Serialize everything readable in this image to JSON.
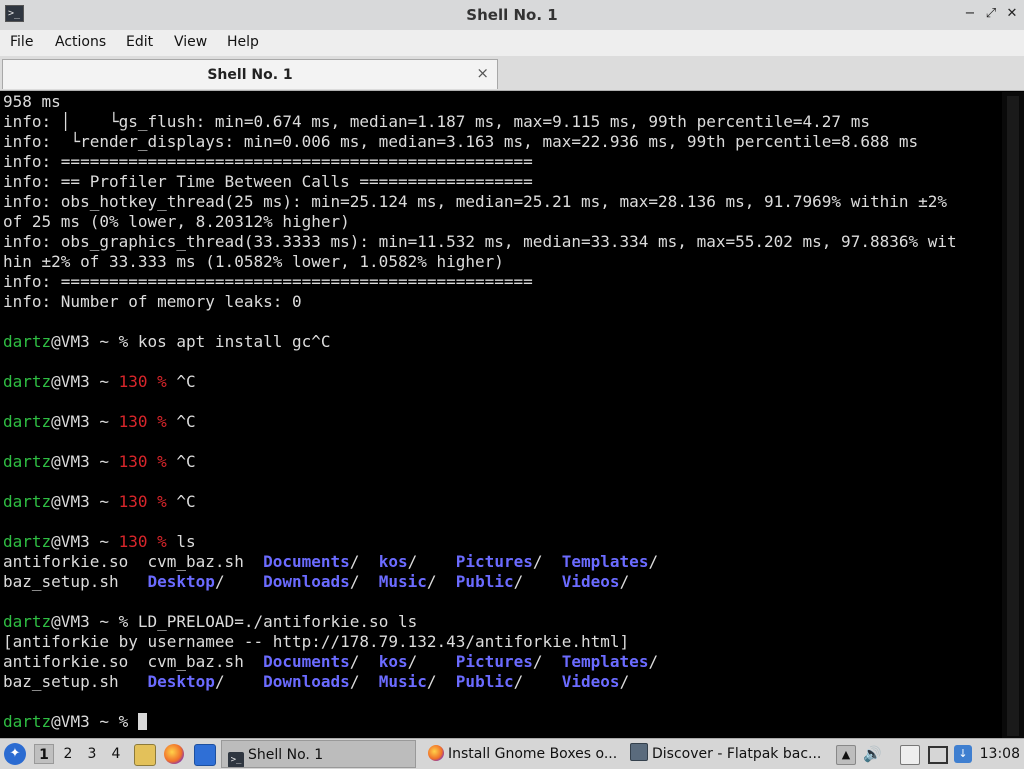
{
  "window": {
    "title": "Shell No. 1",
    "app_icon_glyph": ">_",
    "buttons": {
      "minimize": "−",
      "maximize": "⤢",
      "close": "✕"
    }
  },
  "menu": {
    "items": [
      "File",
      "Actions",
      "Edit",
      "View",
      "Help"
    ]
  },
  "tab": {
    "label": "Shell No. 1",
    "close": "×"
  },
  "terminal": {
    "lines": [
      [
        {
          "t": "958 ms",
          "c": "normal"
        }
      ],
      [
        {
          "t": "info: │    └gs_flush: min=0.674 ms, median=1.187 ms, max=9.115 ms, 99th percentile=4.27 ms",
          "c": "normal"
        }
      ],
      [
        {
          "t": "info:  └render_displays: min=0.006 ms, median=3.163 ms, max=22.936 ms, 99th percentile=8.688 ms",
          "c": "normal"
        }
      ],
      [
        {
          "t": "info: =================================================",
          "c": "normal"
        }
      ],
      [
        {
          "t": "info: == Profiler Time Between Calls ==================",
          "c": "normal"
        }
      ],
      [
        {
          "t": "info: obs_hotkey_thread(25 ms): min=25.124 ms, median=25.21 ms, max=28.136 ms, 91.7969% within ±2%",
          "c": "normal"
        }
      ],
      [
        {
          "t": "of 25 ms (0% lower, 8.20312% higher)",
          "c": "normal"
        }
      ],
      [
        {
          "t": "info: obs_graphics_thread(33.3333 ms): min=11.532 ms, median=33.334 ms, max=55.202 ms, 97.8836% wit",
          "c": "normal"
        }
      ],
      [
        {
          "t": "hin ±2% of 33.333 ms (1.0582% lower, 1.0582% higher)",
          "c": "normal"
        }
      ],
      [
        {
          "t": "info: =================================================",
          "c": "normal"
        }
      ],
      [
        {
          "t": "info: Number of memory leaks: 0",
          "c": "normal"
        }
      ],
      [],
      [
        {
          "t": "dartz",
          "c": "green"
        },
        {
          "t": "@VM3 ~ % kos apt install gc^C",
          "c": "normal"
        }
      ],
      [],
      [
        {
          "t": "dartz",
          "c": "green"
        },
        {
          "t": "@VM3 ~ ",
          "c": "normal"
        },
        {
          "t": "130 %",
          "c": "red"
        },
        {
          "t": " ^C",
          "c": "normal"
        }
      ],
      [],
      [
        {
          "t": "dartz",
          "c": "green"
        },
        {
          "t": "@VM3 ~ ",
          "c": "normal"
        },
        {
          "t": "130 %",
          "c": "red"
        },
        {
          "t": " ^C",
          "c": "normal"
        }
      ],
      [],
      [
        {
          "t": "dartz",
          "c": "green"
        },
        {
          "t": "@VM3 ~ ",
          "c": "normal"
        },
        {
          "t": "130 %",
          "c": "red"
        },
        {
          "t": " ^C",
          "c": "normal"
        }
      ],
      [],
      [
        {
          "t": "dartz",
          "c": "green"
        },
        {
          "t": "@VM3 ~ ",
          "c": "normal"
        },
        {
          "t": "130 %",
          "c": "red"
        },
        {
          "t": " ^C",
          "c": "normal"
        }
      ],
      [],
      [
        {
          "t": "dartz",
          "c": "green"
        },
        {
          "t": "@VM3 ~ ",
          "c": "normal"
        },
        {
          "t": "130 %",
          "c": "red"
        },
        {
          "t": " ls",
          "c": "normal"
        }
      ],
      [
        {
          "t": "antiforkie.so  cvm_baz.sh  ",
          "c": "normal"
        },
        {
          "t": "Documents",
          "c": "dir"
        },
        {
          "t": "/  ",
          "c": "normal"
        },
        {
          "t": "kos",
          "c": "dir"
        },
        {
          "t": "/    ",
          "c": "normal"
        },
        {
          "t": "Pictures",
          "c": "dir"
        },
        {
          "t": "/  ",
          "c": "normal"
        },
        {
          "t": "Templates",
          "c": "dir"
        },
        {
          "t": "/",
          "c": "normal"
        }
      ],
      [
        {
          "t": "baz_setup.sh   ",
          "c": "normal"
        },
        {
          "t": "Desktop",
          "c": "dir"
        },
        {
          "t": "/    ",
          "c": "normal"
        },
        {
          "t": "Downloads",
          "c": "dir"
        },
        {
          "t": "/  ",
          "c": "normal"
        },
        {
          "t": "Music",
          "c": "dir"
        },
        {
          "t": "/  ",
          "c": "normal"
        },
        {
          "t": "Public",
          "c": "dir"
        },
        {
          "t": "/    ",
          "c": "normal"
        },
        {
          "t": "Videos",
          "c": "dir"
        },
        {
          "t": "/",
          "c": "normal"
        }
      ],
      [],
      [
        {
          "t": "dartz",
          "c": "green"
        },
        {
          "t": "@VM3 ~ % LD_PRELOAD=./antiforkie.so ls",
          "c": "normal"
        }
      ],
      [
        {
          "t": "[antiforkie by usernamee -- http://178.79.132.43/antiforkie.html]",
          "c": "normal"
        }
      ],
      [
        {
          "t": "antiforkie.so  cvm_baz.sh  ",
          "c": "normal"
        },
        {
          "t": "Documents",
          "c": "dir"
        },
        {
          "t": "/  ",
          "c": "normal"
        },
        {
          "t": "kos",
          "c": "dir"
        },
        {
          "t": "/    ",
          "c": "normal"
        },
        {
          "t": "Pictures",
          "c": "dir"
        },
        {
          "t": "/  ",
          "c": "normal"
        },
        {
          "t": "Templates",
          "c": "dir"
        },
        {
          "t": "/",
          "c": "normal"
        }
      ],
      [
        {
          "t": "baz_setup.sh   ",
          "c": "normal"
        },
        {
          "t": "Desktop",
          "c": "dir"
        },
        {
          "t": "/    ",
          "c": "normal"
        },
        {
          "t": "Downloads",
          "c": "dir"
        },
        {
          "t": "/  ",
          "c": "normal"
        },
        {
          "t": "Music",
          "c": "dir"
        },
        {
          "t": "/  ",
          "c": "normal"
        },
        {
          "t": "Public",
          "c": "dir"
        },
        {
          "t": "/    ",
          "c": "normal"
        },
        {
          "t": "Videos",
          "c": "dir"
        },
        {
          "t": "/",
          "c": "normal"
        }
      ],
      [],
      [
        {
          "t": "dartz",
          "c": "green"
        },
        {
          "t": "@VM3 ~ % ",
          "c": "normal"
        }
      ]
    ]
  },
  "taskbar": {
    "start_glyph": "✦",
    "workspaces": [
      "1",
      "2",
      "3",
      "4"
    ],
    "active_workspace": "1",
    "launchers": [
      "file-manager-icon",
      "firefox-icon",
      "desktop-icon"
    ],
    "tasks": [
      {
        "label": "Shell No. 1",
        "icon": "terminal-icon",
        "active": true
      },
      {
        "label": "Install Gnome Boxes o...",
        "icon": "firefox-icon",
        "active": false
      },
      {
        "label": "Discover - Flatpak bac...",
        "icon": "discover-icon",
        "active": false
      }
    ],
    "tray": [
      "volume-up-icon",
      "volume-icon",
      "clipboard-icon",
      "network-icon",
      "update-icon"
    ],
    "clock": "13:08"
  },
  "colors": {
    "prompt_user": "#2fbf43",
    "exit_code": "#d9262b",
    "directory": "#6b6bff",
    "terminal_bg": "#000000",
    "terminal_fg": "#dcdcdc"
  }
}
